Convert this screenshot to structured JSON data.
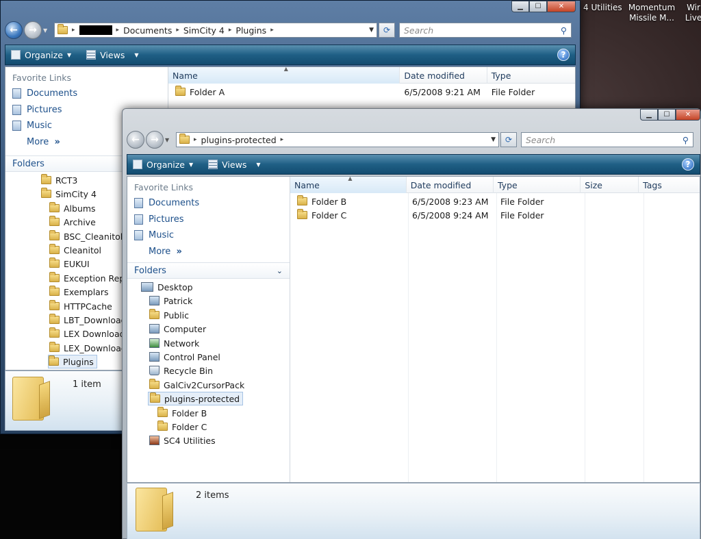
{
  "desktop": {
    "label_1": "4 Utilities",
    "label_2": "Momentum Missile M...",
    "label_3": "Wir Live"
  },
  "back_window": {
    "address": [
      "Documents",
      "SimCity 4",
      "Plugins"
    ],
    "search_placeholder": "Search",
    "toolbar": {
      "organize": "Organize",
      "views": "Views"
    },
    "favorite_links_title": "Favorite Links",
    "favorites": [
      "Documents",
      "Pictures",
      "Music"
    ],
    "more": "More",
    "folders_title": "Folders",
    "tree": [
      "RCT3",
      "SimCity 4",
      "Albums",
      "Archive",
      "BSC_Cleanitol",
      "Cleanitol",
      "EUKUI",
      "Exception Repo",
      "Exemplars",
      "HTTPCache",
      "LBT_Download",
      "LEX Downloads",
      "LEX_Download",
      "Plugins"
    ],
    "columns": {
      "name": "Name",
      "date": "Date modified",
      "type": "Type"
    },
    "files": [
      {
        "name": "Folder A",
        "date": "6/5/2008 9:21 AM",
        "type": "File Folder"
      }
    ],
    "item_count": "1 item"
  },
  "front_window": {
    "address": [
      "plugins-protected"
    ],
    "search_placeholder": "Search",
    "toolbar": {
      "organize": "Organize",
      "views": "Views"
    },
    "favorite_links_title": "Favorite Links",
    "favorites": [
      "Documents",
      "Pictures",
      "Music"
    ],
    "more": "More",
    "folders_title": "Folders",
    "tree": [
      "Desktop",
      "Patrick",
      "Public",
      "Computer",
      "Network",
      "Control Panel",
      "Recycle Bin",
      "GalCiv2CursorPack",
      "plugins-protected",
      "Folder B",
      "Folder C",
      "SC4 Utilities"
    ],
    "columns": {
      "name": "Name",
      "date": "Date modified",
      "type": "Type",
      "size": "Size",
      "tags": "Tags"
    },
    "files": [
      {
        "name": "Folder B",
        "date": "6/5/2008 9:23 AM",
        "type": "File Folder"
      },
      {
        "name": "Folder C",
        "date": "6/5/2008 9:24 AM",
        "type": "File Folder"
      }
    ],
    "item_count": "2 items"
  }
}
